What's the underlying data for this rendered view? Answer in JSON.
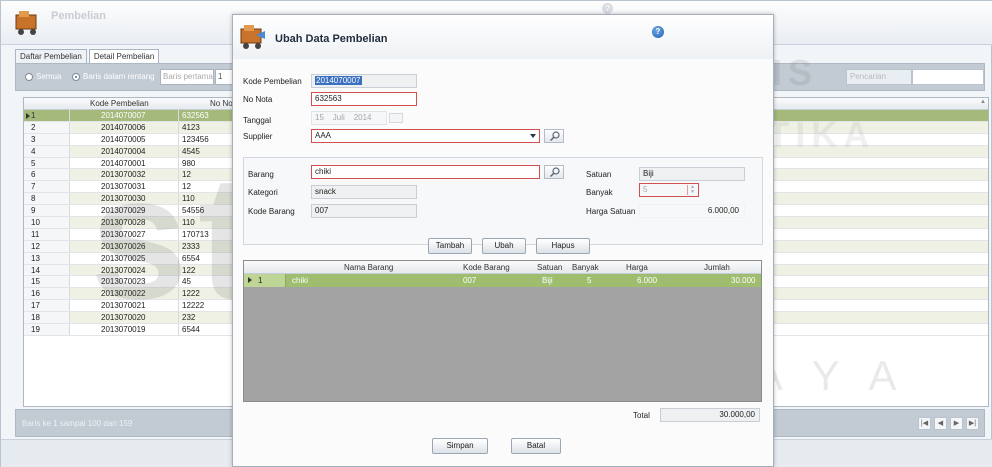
{
  "app": {
    "title": "Pembelian",
    "help_glyph": "?"
  },
  "tabs": [
    {
      "label": "Daftar Pembelian",
      "active": false
    },
    {
      "label": "Detail Pembelian",
      "active": true
    }
  ],
  "filter": {
    "option_all": "Semua",
    "option_range": "Baris dalam rentang",
    "range_label": "Baris pertama",
    "range_value": "1",
    "search_label": "Pencarian"
  },
  "grid": {
    "columns": [
      "Kode Pembelian",
      "No Not"
    ],
    "rows": [
      {
        "no": "1",
        "kode": "2014070007",
        "nota": "632563",
        "selected": true
      },
      {
        "no": "2",
        "kode": "2014070006",
        "nota": "4123"
      },
      {
        "no": "3",
        "kode": "2014070005",
        "nota": "123456"
      },
      {
        "no": "4",
        "kode": "2014070004",
        "nota": "4545"
      },
      {
        "no": "5",
        "kode": "2014070001",
        "nota": "980"
      },
      {
        "no": "6",
        "kode": "2013070032",
        "nota": "12"
      },
      {
        "no": "7",
        "kode": "2013070031",
        "nota": "12"
      },
      {
        "no": "8",
        "kode": "2013070030",
        "nota": "110"
      },
      {
        "no": "9",
        "kode": "2013070029",
        "nota": "54556"
      },
      {
        "no": "10",
        "kode": "2013070028",
        "nota": "110"
      },
      {
        "no": "11",
        "kode": "2013070027",
        "nota": "170713"
      },
      {
        "no": "12",
        "kode": "2013070026",
        "nota": "2333"
      },
      {
        "no": "13",
        "kode": "2013070025",
        "nota": "6554"
      },
      {
        "no": "14",
        "kode": "2013070024",
        "nota": "122"
      },
      {
        "no": "15",
        "kode": "2013070023",
        "nota": "45"
      },
      {
        "no": "16",
        "kode": "2013070022",
        "nota": "1222"
      },
      {
        "no": "17",
        "kode": "2013070021",
        "nota": "12222"
      },
      {
        "no": "18",
        "kode": "2013070020",
        "nota": "232"
      },
      {
        "no": "19",
        "kode": "2013070019",
        "nota": "6544"
      }
    ],
    "status": "Baris ke 1 sampai 100 dari 159"
  },
  "pager": {
    "first": "|◀",
    "prev": "◀",
    "next": "▶",
    "last": "▶|"
  },
  "dialog": {
    "title": "Ubah Data Pembelian",
    "kode_pembelian_label": "Kode Pembelian",
    "kode_pembelian_value": "2014070007",
    "no_nota_label": "No Nota",
    "no_nota_value": "632563",
    "tanggal_label": "Tanggal",
    "tanggal_day": "15",
    "tanggal_month": "Juli",
    "tanggal_year": "2014",
    "supplier_label": "Supplier",
    "supplier_value": "AAA",
    "barang_label": "Barang",
    "barang_value": "chiki",
    "kategori_label": "Kategori",
    "kategori_value": "snack",
    "kode_barang_label": "Kode Barang",
    "kode_barang_value": "007",
    "satuan_label": "Satuan",
    "satuan_value": "Biji",
    "banyak_label": "Banyak",
    "banyak_value": "5",
    "harga_satuan_label": "Harga Satuan",
    "harga_satuan_value": "6.000,00",
    "btn_tambah": "Tambah",
    "btn_ubah": "Ubah",
    "btn_hapus": "Hapus",
    "detail_columns": [
      "Nama Barang",
      "Kode Barang",
      "Satuan",
      "Banyak",
      "Harga",
      "Jumlah"
    ],
    "detail_row": {
      "no": "1",
      "nama": "chiki",
      "kode": "007",
      "satuan": "Biji",
      "banyak": "5",
      "harga": "6.000",
      "jumlah": "30.000"
    },
    "total_label": "Total",
    "total_value": "30.000,00",
    "btn_simpan": "Simpan",
    "btn_batal": "Batal"
  },
  "watermark": {
    "line1": "INSTITUT BISNIS",
    "line2": "& INFORMATIKA",
    "logo": "stikom",
    "line3": "SURABAYA"
  },
  "colors": {
    "selected_row": "#a4b97a",
    "detail_selected_row": "#9ebd6f",
    "invalid_border": "#d05050",
    "highlight_blue": "#3b6fc0"
  }
}
